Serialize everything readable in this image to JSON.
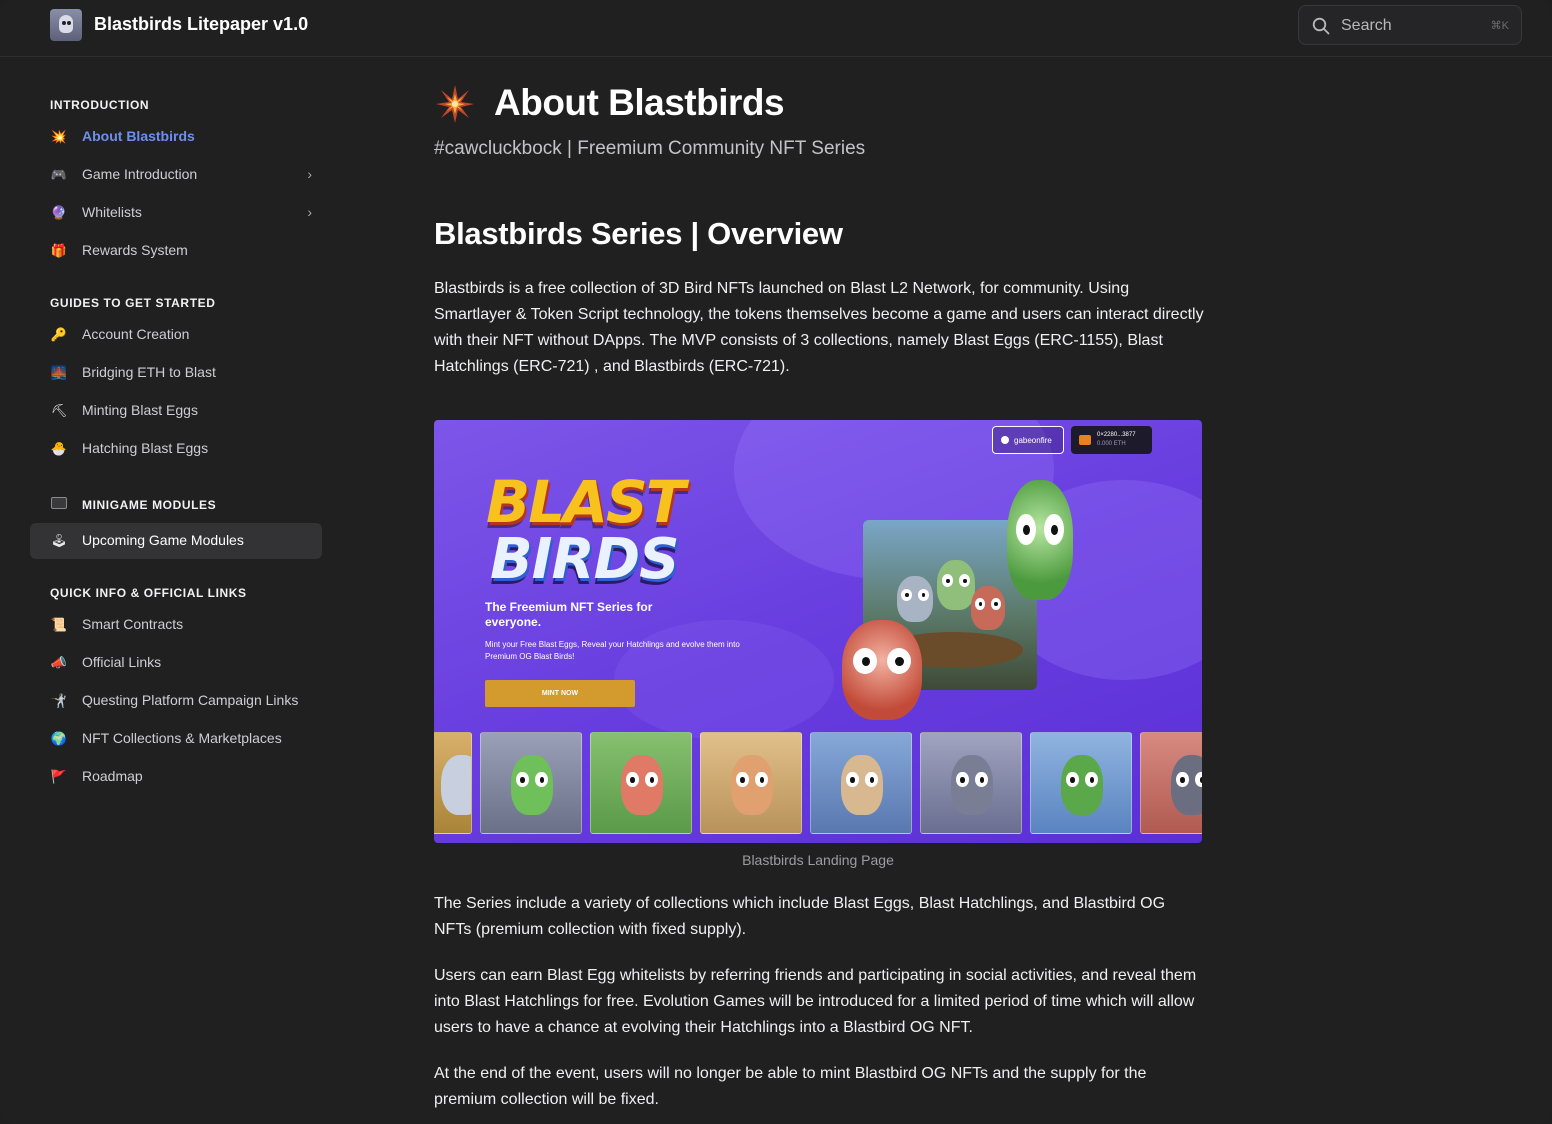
{
  "header": {
    "site_title": "Blastbirds Litepaper v1.0",
    "search_placeholder": "Search",
    "search_shortcut": "⌘K"
  },
  "sidebar": {
    "sections": [
      {
        "title": "INTRODUCTION"
      },
      {
        "title": "GUIDES TO GET STARTED"
      },
      {
        "title": "MINIGAME MODULES"
      },
      {
        "title": "QUICK INFO & OFFICIAL LINKS"
      }
    ],
    "items": [
      {
        "label": "About Blastbirds",
        "icon": "💥",
        "icon_name": "burst-icon",
        "active": true
      },
      {
        "label": "Game Introduction",
        "icon": "🎮",
        "icon_name": "gamepad-icon",
        "has_children": true
      },
      {
        "label": "Whitelists",
        "icon": "🔮",
        "icon_name": "orb-icon",
        "has_children": true
      },
      {
        "label": "Rewards System",
        "icon": "🎁",
        "icon_name": "gift-icon"
      },
      {
        "label": "Account Creation",
        "icon": "🔑",
        "icon_name": "key-icon"
      },
      {
        "label": "Bridging ETH to Blast",
        "icon": "🌉",
        "icon_name": "bridge-icon"
      },
      {
        "label": "Minting Blast Eggs",
        "icon": "⛏",
        "icon_name": "pickaxe-icon"
      },
      {
        "label": "Hatching Blast Eggs",
        "icon": "🐣",
        "icon_name": "hatching-chick-icon"
      },
      {
        "label": "Upcoming Game Modules",
        "icon": "🕹",
        "icon_name": "joystick-icon",
        "highlighted": true
      },
      {
        "label": "Smart Contracts",
        "icon": "📜",
        "icon_name": "scroll-icon"
      },
      {
        "label": "Official Links",
        "icon": "📣",
        "icon_name": "megaphone-icon"
      },
      {
        "label": "Questing Platform Campaign Links",
        "icon": "🤺",
        "icon_name": "fencer-icon"
      },
      {
        "label": "NFT Collections & Marketplaces",
        "icon": "🌍",
        "icon_name": "globe-icon"
      },
      {
        "label": "Roadmap",
        "icon": "🚩",
        "icon_name": "flag-icon"
      }
    ]
  },
  "main": {
    "title": "About Blastbirds",
    "subtitle": "#cawcluckbock | Freemium Community NFT Series",
    "section_heading": "Blastbirds Series | Overview",
    "paragraph_1": "Blastbirds is a free collection of 3D Bird NFTs launched on Blast L2 Network, for community. Using Smartlayer & Token Script technology, the tokens themselves become a game and users can interact directly with their NFT without DApps. The MVP consists of 3 collections, namely Blast Eggs (ERC-1155), Blast Hatchlings (ERC-721) , and Blastbirds (ERC-721).",
    "figure": {
      "user_pill": "gabeonfire",
      "wallet_address": "0×2280...3877",
      "wallet_balance": "0.000 ETH",
      "logo_line_1": "BLAST",
      "logo_line_2": "BIRDS",
      "tagline": "The Freemium NFT Series for everyone.",
      "description": "Mint your Free Blast Eggs, Reveal your Hatchlings and evolve them into Premium OG Blast Birds!",
      "mint_button": "MINT NOW",
      "caption": "Blastbirds Landing Page"
    },
    "paragraph_2": "The Series include a variety of collections which include Blast Eggs, Blast Hatchlings, and Blastbird OG NFTs (premium collection with fixed supply).",
    "paragraph_3": "Users can earn Blast Egg whitelists by referring friends and participating in social activities, and reveal them into Blast Hatchlings for free. Evolution Games will be introduced for a limited period of time which will allow users to have a chance at evolving their Hatchlings into a Blastbird OG NFT.",
    "paragraph_4": "At the end of the event, users will no longer be able to mint Blastbird OG NFTs and the supply for the premium collection will be fixed."
  },
  "colors": {
    "accent": "#6e8ff0",
    "background": "#202021",
    "figure_purple": "#6a3fe0",
    "mint_button": "#d39b2e"
  }
}
